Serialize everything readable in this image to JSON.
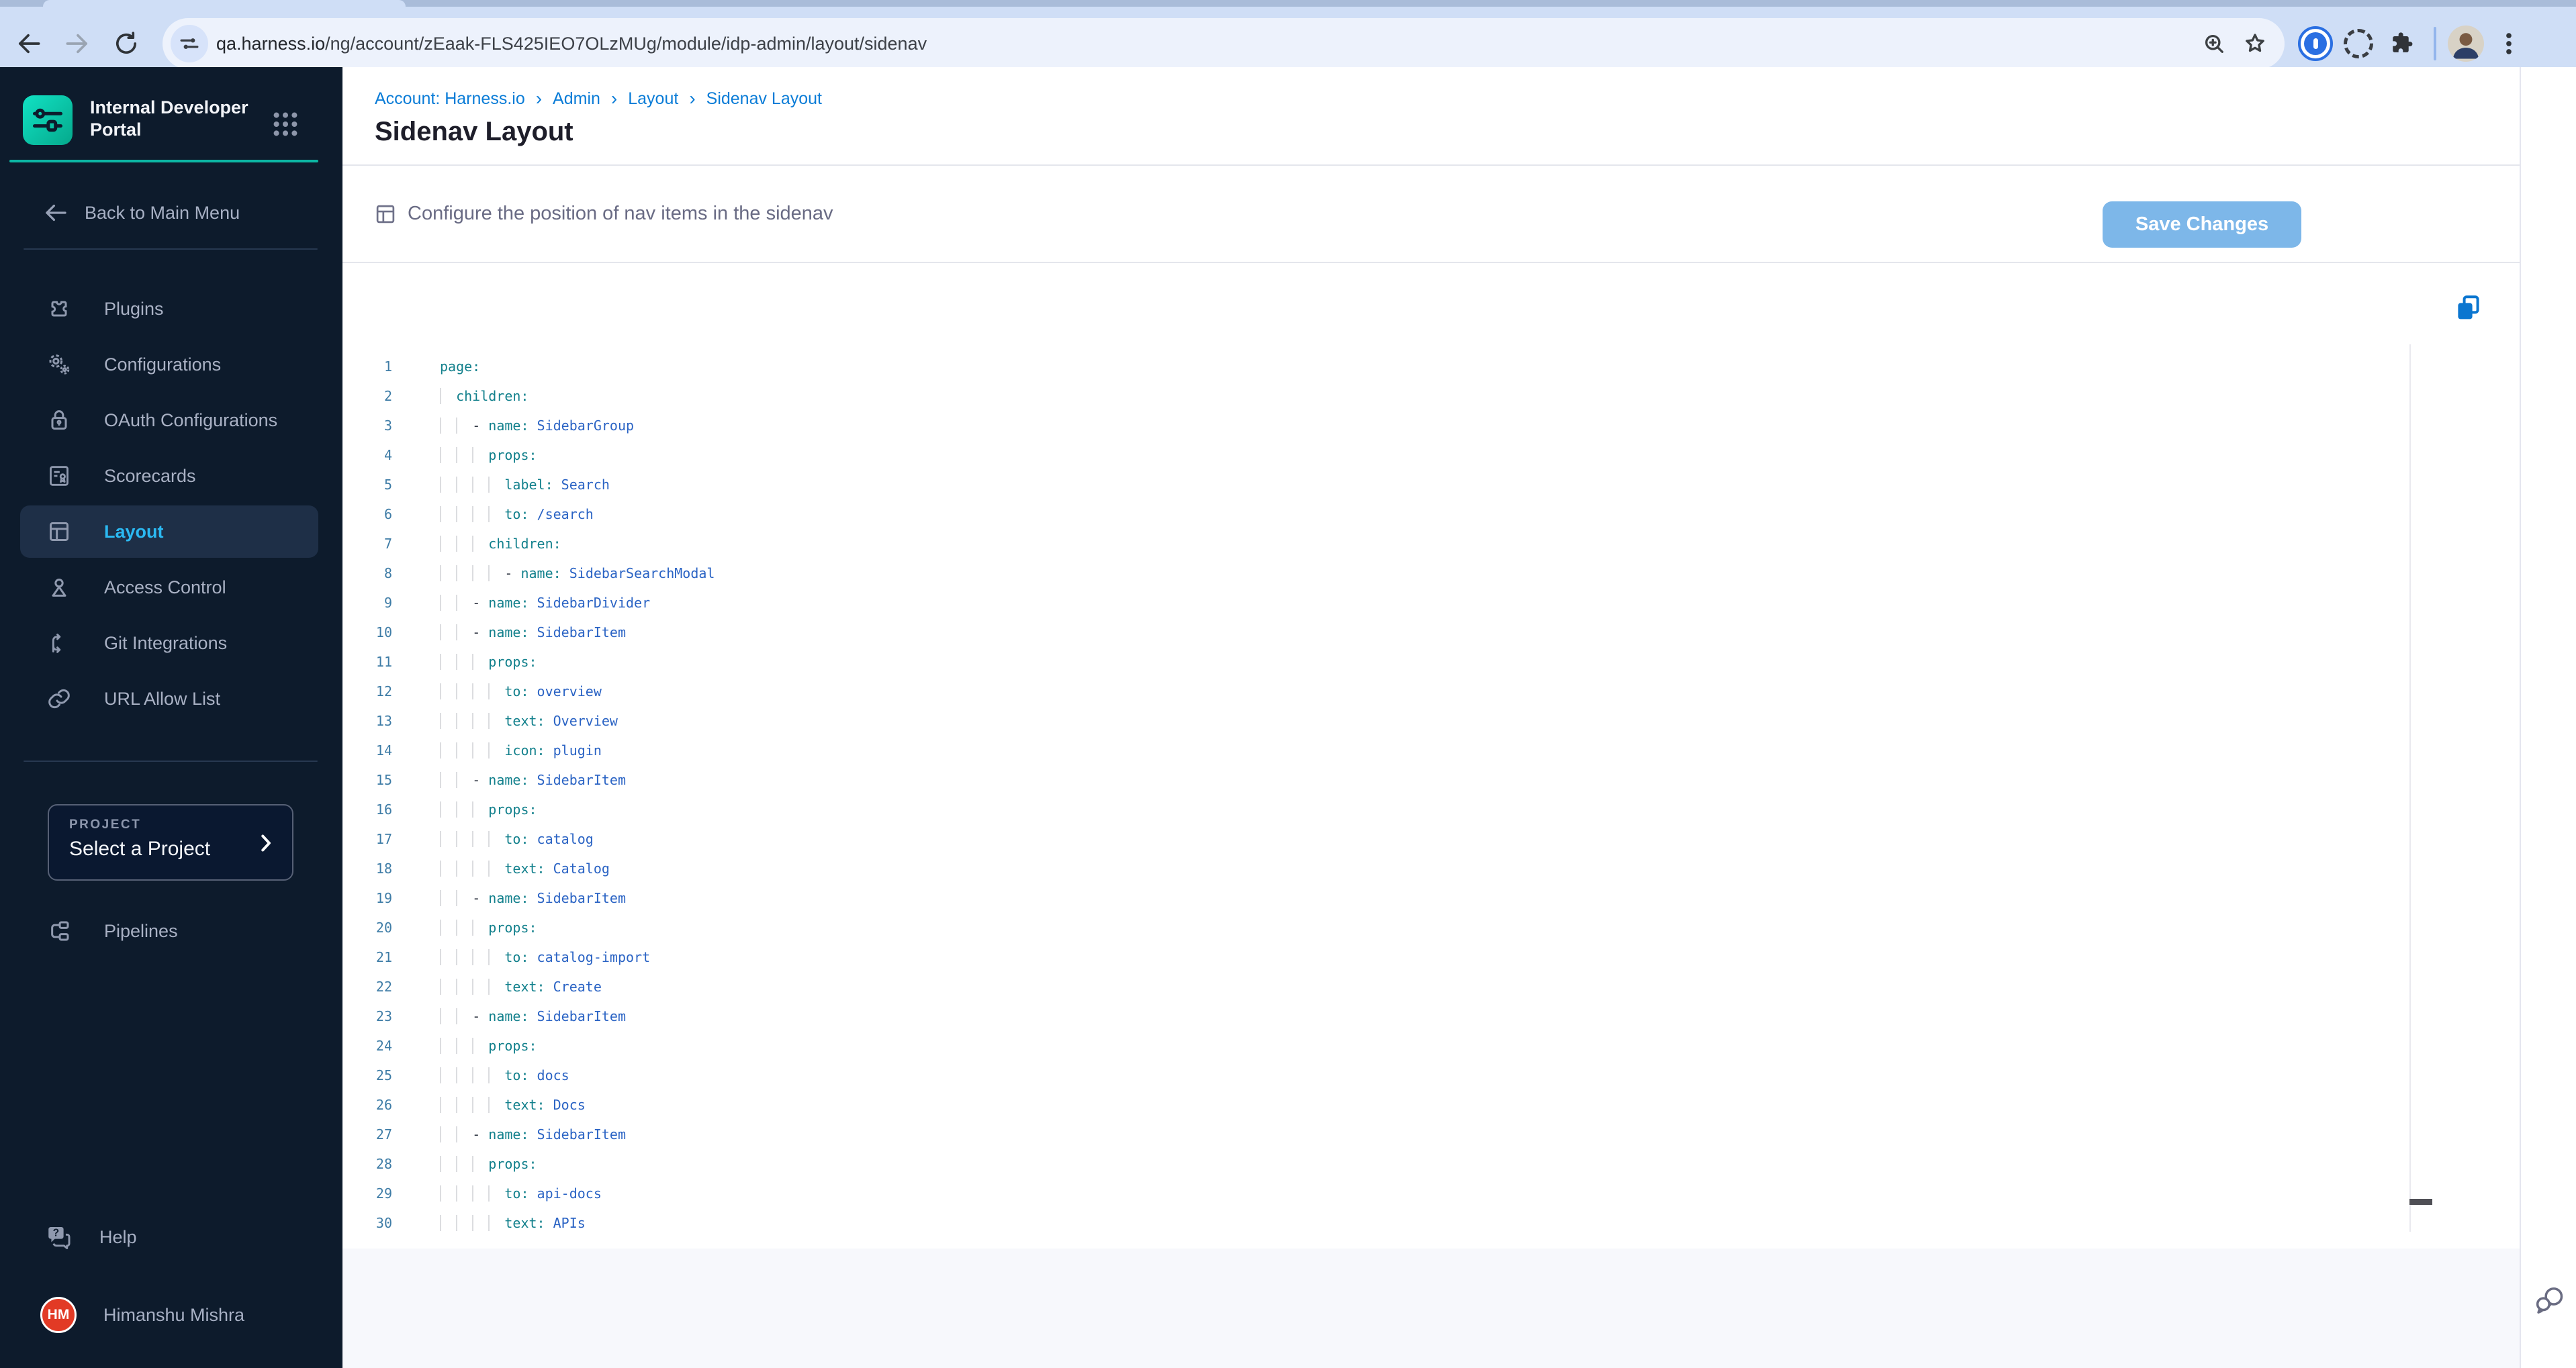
{
  "browser": {
    "url_domain": "qa.harness.io",
    "url_path": "/ng/account/zEaak-FLS425IEO7OLzMUg/module/idp-admin/layout/sidenav"
  },
  "sidebar": {
    "logo_title": "Internal Developer Portal",
    "back_label": "Back to Main Menu",
    "items": [
      {
        "label": "Plugins",
        "icon": "plugin-icon",
        "active": false
      },
      {
        "label": "Configurations",
        "icon": "configurations-icon",
        "active": false
      },
      {
        "label": "OAuth Configurations",
        "icon": "lock-icon",
        "active": false
      },
      {
        "label": "Scorecards",
        "icon": "scorecard-icon",
        "active": false
      },
      {
        "label": "Layout",
        "icon": "layout-icon",
        "active": true
      },
      {
        "label": "Access Control",
        "icon": "person-icon",
        "active": false
      },
      {
        "label": "Git Integrations",
        "icon": "git-branch-icon",
        "active": false
      },
      {
        "label": "URL Allow List",
        "icon": "link-icon",
        "active": false
      }
    ],
    "project_label": "PROJECT",
    "project_value": "Select a Project",
    "pipelines_label": "Pipelines",
    "help_label": "Help",
    "user_initials": "HM",
    "user_name": "Himanshu Mishra"
  },
  "header": {
    "breadcrumbs": [
      "Account: Harness.io",
      "Admin",
      "Layout",
      "Sidenav Layout"
    ],
    "title": "Sidenav Layout"
  },
  "config_bar": {
    "description": "Configure the position of nav items in the sidenav",
    "save_label": "Save Changes"
  },
  "editor": {
    "language": "yaml",
    "lines": [
      "page:",
      "  children:",
      "    - name: SidebarGroup",
      "      props:",
      "        label: Search",
      "        to: /search",
      "      children:",
      "        - name: SidebarSearchModal",
      "    - name: SidebarDivider",
      "    - name: SidebarItem",
      "      props:",
      "        to: overview",
      "        text: Overview",
      "        icon: plugin",
      "    - name: SidebarItem",
      "      props:",
      "        to: catalog",
      "        text: Catalog",
      "    - name: SidebarItem",
      "      props:",
      "        to: catalog-import",
      "        text: Create",
      "    - name: SidebarItem",
      "      props:",
      "        to: docs",
      "        text: Docs",
      "    - name: SidebarItem",
      "      props:",
      "        to: api-docs",
      "        text: APIs"
    ]
  },
  "colors": {
    "sidebar_bg": "#0d1b2c",
    "accent_teal": "#0cb6a3",
    "active_item_text": "#2bb9f2",
    "breadcrumb_blue": "#0a7cd7",
    "save_button": "#7db7e9",
    "code_key": "#12808c",
    "code_value": "#2a63c4",
    "line_number": "#3e7ca6",
    "avatar_red": "#e23a25"
  }
}
